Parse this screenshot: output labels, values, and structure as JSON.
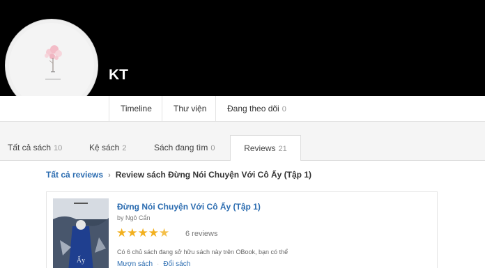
{
  "profile": {
    "name": "KT"
  },
  "subnav": [
    {
      "label": "Timeline"
    },
    {
      "label": "Thư viện"
    },
    {
      "label": "Đang theo dõi",
      "count": "0"
    }
  ],
  "tabs": [
    {
      "label": "Tất cả sách",
      "count": "10"
    },
    {
      "label": "Kệ sách",
      "count": "2"
    },
    {
      "label": "Sách đang tìm",
      "count": "0"
    },
    {
      "label": "Reviews",
      "count": "21",
      "active": true
    }
  ],
  "breadcrumb": {
    "link": "Tất cả reviews",
    "separator": "›",
    "current": "Review sách Đừng Nói Chuyện Với Cô Ấy (Tập 1)"
  },
  "book": {
    "title": "Đừng Nói Chuyện Với Cô Ấy (Tập 1)",
    "author": "by Ngô Cẩn",
    "rating": 4.5,
    "rating_max": 5,
    "reviews": "6 reviews",
    "owners_text": "Có 6 chủ sách đang sở hữu sách này trên OBook, bạn có thể",
    "borrow": "Mượn sách",
    "exchange": "Đổi sách",
    "action_separator": "·"
  },
  "colors": {
    "cover": "#000000",
    "link": "#2b6cb0",
    "star": "#f2b01e",
    "band": "#f5f5f5"
  }
}
